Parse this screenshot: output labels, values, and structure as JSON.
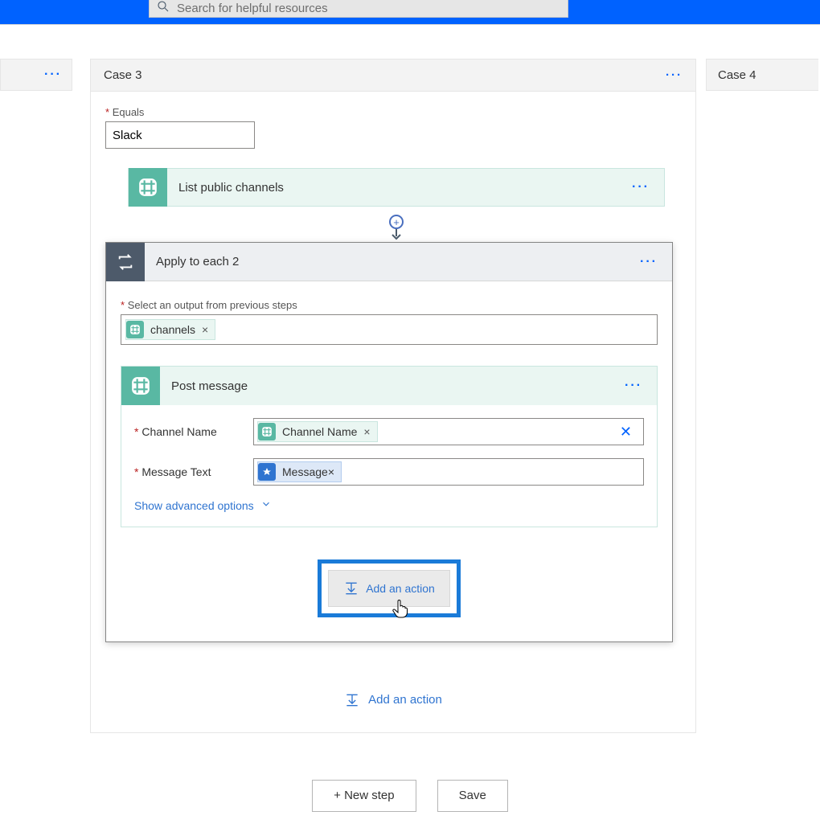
{
  "search": {
    "placeholder": "Search for helpful resources"
  },
  "cases": {
    "case3_title": "Case 3",
    "case4_title": "Case 4"
  },
  "equals": {
    "label": "Equals",
    "value": "Slack"
  },
  "step_list": {
    "title": "List public channels"
  },
  "apply": {
    "title": "Apply to each 2",
    "select_label": "Select an output from previous steps",
    "token": "channels"
  },
  "post": {
    "title": "Post message",
    "channel_label": "Channel Name",
    "channel_token": "Channel Name",
    "message_label": "Message Text",
    "message_token": "Message",
    "adv": "Show advanced options"
  },
  "buttons": {
    "add_action": "Add an action",
    "new_step": "+ New step",
    "save": "Save"
  }
}
